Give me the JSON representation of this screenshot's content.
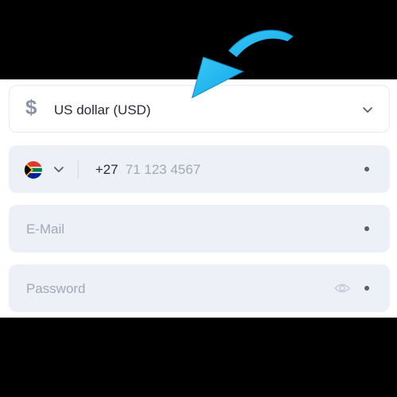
{
  "currency": {
    "symbol": "$",
    "label": "US dollar (USD)",
    "icon": "chevron-down-icon"
  },
  "phone": {
    "country_flag": "south-africa-flag-icon",
    "dial_code": "+27",
    "placeholder": "71 123 4567"
  },
  "email": {
    "placeholder": "E-Mail"
  },
  "password": {
    "placeholder": "Password",
    "toggle_icon": "eye-icon"
  },
  "colors": {
    "arrow": "#1fb7f2",
    "field_bg": "#edf0f7",
    "placeholder": "#a2a8b6",
    "text": "#2a2d35"
  }
}
